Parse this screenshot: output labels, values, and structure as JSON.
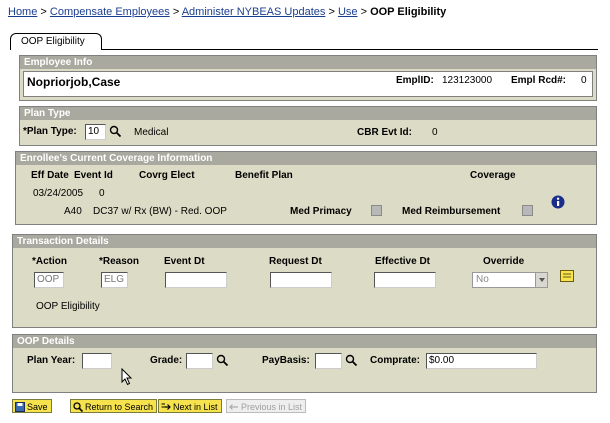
{
  "breadcrumb": {
    "items": [
      "Home",
      "Compensate Employees",
      "Administer NYBEAS Updates",
      "Use"
    ],
    "separator": ">",
    "current": "OOP Eligibility"
  },
  "tab": {
    "label": "OOP Eligibility"
  },
  "employee": {
    "heading": "Employee Info",
    "name": "Nopriorjob,Case",
    "emplid_label": "EmplID:",
    "emplid": "123123000",
    "empl_rcd_label": "Empl Rcd#:",
    "empl_rcd": "0"
  },
  "plan_type": {
    "heading": "Plan Type",
    "label": "*Plan Type:",
    "value": "10",
    "description": "Medical",
    "cbr_label": "CBR Evt Id:",
    "cbr_value": "0"
  },
  "coverage": {
    "heading": "Enrollee's Current Coverage Information",
    "headers": [
      "Eff Date",
      "Event Id",
      "Covrg Elect",
      "Benefit Plan",
      "Coverage"
    ],
    "eff_date": "03/24/2005",
    "event_id": "0",
    "plan_code": "A40",
    "plan_desc": "DC37 w/ Rx (BW) - Red. OOP",
    "med_primacy_label": "Med Primacy",
    "med_reimb_label": "Med Reimbursement",
    "info_icon": "info-icon"
  },
  "transaction": {
    "heading": "Transaction Details",
    "headers": [
      "*Action",
      "*Reason",
      "Event Dt",
      "Request Dt",
      "Effective Dt",
      "Override"
    ],
    "action": "OOP",
    "reason": "ELG",
    "event_dt": "",
    "request_dt": "",
    "effective_dt": "",
    "override": "No",
    "description": "OOP Eligibility"
  },
  "oop": {
    "heading": "OOP Details",
    "plan_year_label": "Plan Year:",
    "plan_year": "",
    "grade_label": "Grade:",
    "grade": "",
    "paybasis_label": "PayBasis:",
    "paybasis": "",
    "comprate_label": "Comprate:",
    "comprate": "$0.00"
  },
  "buttons": {
    "save": "Save",
    "return": "Return to Search",
    "next": "Next in List",
    "previous": "Previous in List"
  },
  "colors": {
    "panel_bg": "#dcdcc6",
    "header_bg": "#a9a9a0",
    "button_bg": "#f5e24c",
    "link": "#1b3f8f"
  }
}
